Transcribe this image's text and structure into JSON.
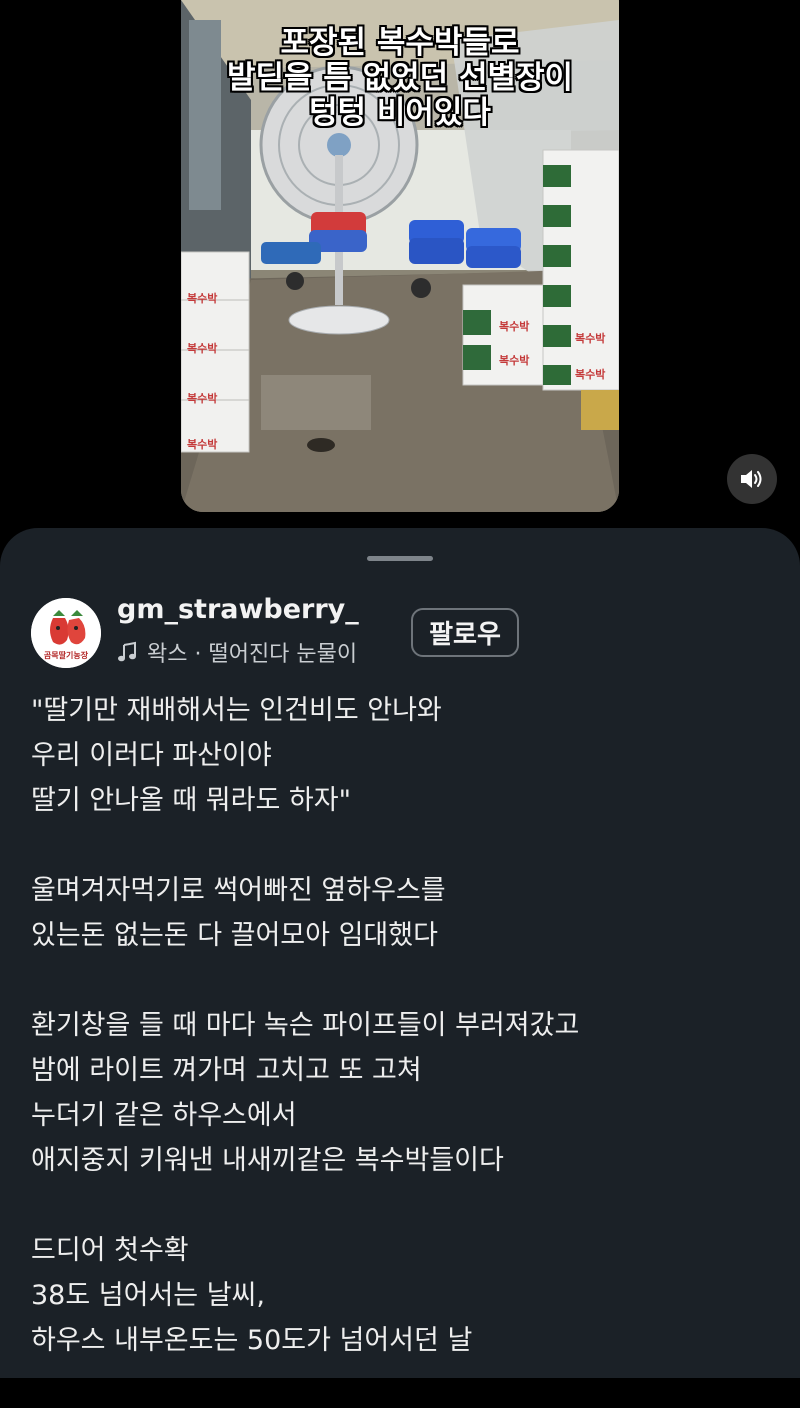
{
  "video": {
    "caption_lines": [
      "포장된 복수박들로",
      "발딛을 틈 없었던 선별장이",
      "텅텅 비어있다"
    ],
    "box_label": "복수박",
    "mute_icon": "speaker-icon"
  },
  "post": {
    "username": "gm_strawberry_",
    "avatar_text": "곰목딸기농장",
    "music_icon": "music-note-icon",
    "music_text": "왁스 · 떨어진다 눈물이",
    "follow_label": "팔로우",
    "paragraphs": [
      [
        "\"딸기만 재배해서는 인건비도 안나와",
        "우리 이러다 파산이야",
        "딸기 안나올 때 뭐라도 하자\""
      ],
      [
        "울며겨자먹기로 썩어빠진 옆하우스를",
        "있는돈 없는돈 다 끌어모아 임대했다"
      ],
      [
        "환기창을 들 때 마다 녹슨 파이프들이 부러져갔고",
        "밤에 라이트 껴가며 고치고 또 고쳐",
        "누더기 같은 하우스에서",
        "애지중지 키워낸 내새끼같은 복수박들이다"
      ],
      [
        "드디어 첫수확",
        "38도 넘어서는 날씨,",
        "하우스 내부온도는 50도가 넘어서던 날"
      ]
    ]
  }
}
